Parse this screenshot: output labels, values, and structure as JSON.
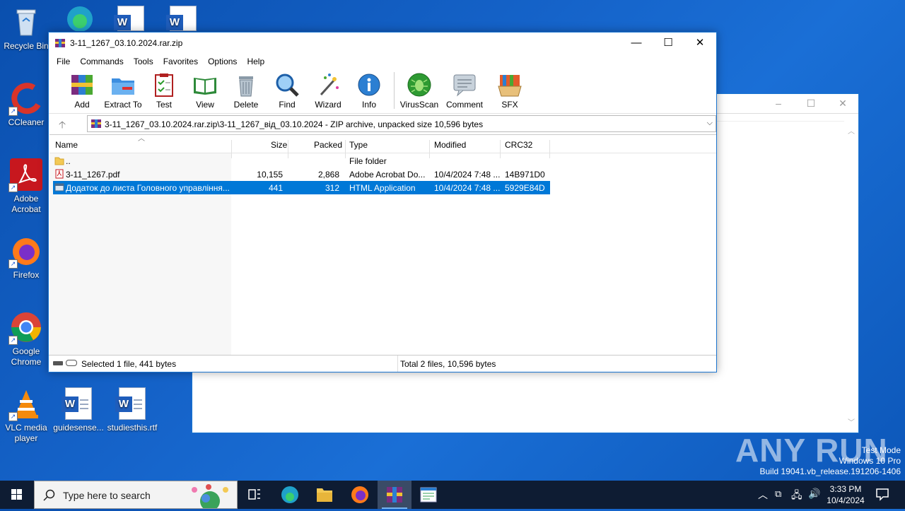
{
  "desktop": {
    "icons": [
      {
        "label": "Recycle Bin"
      },
      {
        "label": "CCleaner"
      },
      {
        "label": "Adobe Acrobat"
      },
      {
        "label": "Firefox"
      },
      {
        "label": "Google Chrome"
      },
      {
        "label": "VLC media player"
      },
      {
        "label": "guidesense..."
      },
      {
        "label": "studiesthis.rtf"
      }
    ]
  },
  "winrar": {
    "title": "3-11_1267_03.10.2024.rar.zip",
    "menu": [
      "File",
      "Commands",
      "Tools",
      "Favorites",
      "Options",
      "Help"
    ],
    "toolbar": [
      "Add",
      "Extract To",
      "Test",
      "View",
      "Delete",
      "Find",
      "Wizard",
      "Info",
      "VirusScan",
      "Comment",
      "SFX"
    ],
    "address": "3-11_1267_03.10.2024.rar.zip\\3-11_1267_від_03.10.2024 - ZIP archive, unpacked size 10,596 bytes",
    "columns": [
      "Name",
      "Size",
      "Packed",
      "Type",
      "Modified",
      "CRC32"
    ],
    "rows": [
      {
        "name": "..",
        "size": "",
        "packed": "",
        "type": "File folder",
        "modified": "",
        "crc": ""
      },
      {
        "name": "3-11_1267.pdf",
        "size": "10,155",
        "packed": "2,868",
        "type": "Adobe Acrobat Do...",
        "modified": "10/4/2024 7:48 ...",
        "crc": "14B971D0"
      },
      {
        "name": "Додаток до листа Головного управління...",
        "size": "441",
        "packed": "312",
        "type": "HTML Application",
        "modified": "10/4/2024 7:48 ...",
        "crc": "5929E84D"
      }
    ],
    "status_left": "Selected 1 file, 441 bytes",
    "status_right": "Total 2 files, 10,596 bytes"
  },
  "taskbar": {
    "search_placeholder": "Type here to search",
    "time": "3:33 PM",
    "date": "10/4/2024"
  },
  "watermark": {
    "line1": "Test Mode",
    "line2": "Windows 10 Pro",
    "line3": "Build 19041.vb_release.191206-1406",
    "brand": "ANY RUN"
  }
}
